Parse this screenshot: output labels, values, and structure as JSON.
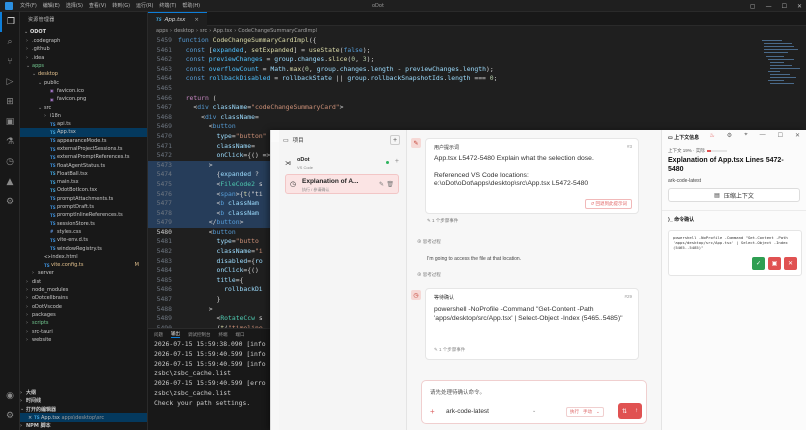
{
  "titlebar": {
    "menus": [
      "文件(F)",
      "编辑(E)",
      "选择(S)",
      "查看(V)",
      "转到(G)",
      "运行(R)",
      "终端(T)",
      "帮助(H)"
    ],
    "title": "oDot"
  },
  "explorer": {
    "header": "资源管理器",
    "root": "ODOT",
    "items": [
      {
        "label": ".codegraph",
        "type": "folder",
        "depth": 1,
        "open": false
      },
      {
        "label": ".github",
        "type": "folder",
        "depth": 1,
        "open": false
      },
      {
        "label": ".idea",
        "type": "folder",
        "depth": 1,
        "open": false
      },
      {
        "label": "apps",
        "type": "folder",
        "depth": 1,
        "open": true,
        "status": "green"
      },
      {
        "label": "desktop",
        "type": "folder",
        "depth": 2,
        "open": true,
        "status": "orange"
      },
      {
        "label": "public",
        "type": "folder",
        "depth": 3,
        "open": true
      },
      {
        "label": "favicon.ico",
        "type": "img",
        "depth": 4
      },
      {
        "label": "favicon.png",
        "type": "img",
        "depth": 4
      },
      {
        "label": "src",
        "type": "folder",
        "depth": 3,
        "open": true
      },
      {
        "label": "i18n",
        "type": "folder",
        "depth": 4,
        "open": false
      },
      {
        "label": "api.ts",
        "type": "ts",
        "depth": 4
      },
      {
        "label": "App.tsx",
        "type": "tsx",
        "depth": 4,
        "selected": true
      },
      {
        "label": "appearanceMode.ts",
        "type": "ts",
        "depth": 4
      },
      {
        "label": "externalProjectSessions.ts",
        "type": "ts",
        "depth": 4
      },
      {
        "label": "externalPromptReferences.ts",
        "type": "ts",
        "depth": 4
      },
      {
        "label": "floatAgentStatus.ts",
        "type": "ts",
        "depth": 4
      },
      {
        "label": "FloatBall.tsx",
        "type": "tsx",
        "depth": 4
      },
      {
        "label": "main.tsx",
        "type": "tsx",
        "depth": 4
      },
      {
        "label": "OdotBotIcon.tsx",
        "type": "tsx",
        "depth": 4
      },
      {
        "label": "promptAttachments.ts",
        "type": "ts",
        "depth": 4
      },
      {
        "label": "promptDraft.ts",
        "type": "ts",
        "depth": 4
      },
      {
        "label": "promptInlineReferences.ts",
        "type": "ts",
        "depth": 4
      },
      {
        "label": "sessionStore.ts",
        "type": "ts",
        "depth": 4
      },
      {
        "label": "styles.css",
        "type": "css",
        "depth": 4
      },
      {
        "label": "vite-env.d.ts",
        "type": "ts",
        "depth": 4
      },
      {
        "label": "windowRegistry.ts",
        "type": "ts",
        "depth": 4
      },
      {
        "label": "index.html",
        "type": "html",
        "depth": 3
      },
      {
        "label": "vite.config.ts",
        "type": "ts",
        "depth": 3,
        "badge": "M"
      },
      {
        "label": "server",
        "type": "folder",
        "depth": 2,
        "open": false
      },
      {
        "label": "dist",
        "type": "folder",
        "depth": 1,
        "open": false
      },
      {
        "label": "node_modules",
        "type": "folder",
        "depth": 1,
        "open": false
      },
      {
        "label": "oDotcellbrains",
        "type": "folder",
        "depth": 1,
        "open": false
      },
      {
        "label": "oDotVscode",
        "type": "folder",
        "depth": 1,
        "open": false
      },
      {
        "label": "packages",
        "type": "folder",
        "depth": 1,
        "open": false
      },
      {
        "label": "scripts",
        "type": "folder",
        "depth": 1,
        "open": false,
        "status": "green"
      },
      {
        "label": "src-tauri",
        "type": "folder",
        "depth": 1,
        "open": false
      },
      {
        "label": "website",
        "type": "folder",
        "depth": 1,
        "open": false
      }
    ],
    "footer": {
      "outline": "大纲",
      "timeline": "时间线",
      "open_editors": "打开的编辑器",
      "open_file": "App.tsx",
      "open_file_path": "apps\\desktop\\src",
      "npm": "NPM 脚本"
    }
  },
  "editor": {
    "tab_label": "App.tsx",
    "breadcrumb": [
      "apps",
      "desktop",
      "src",
      "App.tsx",
      "CodeChangeSummaryCardImpl"
    ],
    "lines": [
      {
        "n": "5459",
        "tokens": [
          [
            "kw",
            "function "
          ],
          [
            "fn",
            "CodeChangeSummaryCardImpl"
          ],
          [
            "pun",
            "({"
          ]
        ]
      },
      {
        "n": "5461",
        "tokens": [
          [
            "pun",
            "  "
          ],
          [
            "kw",
            "const "
          ],
          [
            "pun",
            "["
          ],
          [
            "cst",
            "expanded"
          ],
          [
            "pun",
            ", "
          ],
          [
            "fn",
            "setExpanded"
          ],
          [
            "pun",
            "] = "
          ],
          [
            "fn",
            "useState"
          ],
          [
            "pun",
            "("
          ],
          [
            "kw",
            "false"
          ],
          [
            "pun",
            ");"
          ]
        ]
      },
      {
        "n": "5462",
        "tokens": [
          [
            "pun",
            "  "
          ],
          [
            "kw",
            "const "
          ],
          [
            "cst",
            "previewChanges"
          ],
          [
            "pun",
            " = "
          ],
          [
            "var",
            "group"
          ],
          [
            "pun",
            "."
          ],
          [
            "var",
            "changes"
          ],
          [
            "pun",
            "."
          ],
          [
            "fn",
            "slice"
          ],
          [
            "pun",
            "("
          ],
          [
            "num",
            "0"
          ],
          [
            "pun",
            ", "
          ],
          [
            "num",
            "3"
          ],
          [
            "pun",
            ");"
          ]
        ]
      },
      {
        "n": "5463",
        "tokens": [
          [
            "pun",
            "  "
          ],
          [
            "kw",
            "const "
          ],
          [
            "cst",
            "overflowCount"
          ],
          [
            "pun",
            " = "
          ],
          [
            "var",
            "Math"
          ],
          [
            "pun",
            "."
          ],
          [
            "fn",
            "max"
          ],
          [
            "pun",
            "("
          ],
          [
            "num",
            "0"
          ],
          [
            "pun",
            ", "
          ],
          [
            "var",
            "group"
          ],
          [
            "pun",
            "."
          ],
          [
            "var",
            "changes"
          ],
          [
            "pun",
            "."
          ],
          [
            "var",
            "length"
          ],
          [
            "pun",
            " - "
          ],
          [
            "var",
            "previewChanges"
          ],
          [
            "pun",
            "."
          ],
          [
            "var",
            "length"
          ],
          [
            "pun",
            ");"
          ]
        ]
      },
      {
        "n": "5464",
        "tokens": [
          [
            "pun",
            "  "
          ],
          [
            "kw",
            "const "
          ],
          [
            "cst",
            "rollbackDisabled"
          ],
          [
            "pun",
            " = "
          ],
          [
            "var",
            "rollbackState"
          ],
          [
            "pun",
            " || "
          ],
          [
            "var",
            "group"
          ],
          [
            "pun",
            "."
          ],
          [
            "var",
            "rollbackSnapshotIds"
          ],
          [
            "pun",
            "."
          ],
          [
            "var",
            "length"
          ],
          [
            "pun",
            " === "
          ],
          [
            "num",
            "0"
          ],
          [
            "pun",
            ";"
          ]
        ]
      },
      {
        "n": "5465",
        "tokens": [
          [
            "pun",
            ""
          ]
        ]
      },
      {
        "n": "5466",
        "tokens": [
          [
            "pun",
            "  "
          ],
          [
            "kw2",
            "return"
          ],
          [
            "pun",
            " ("
          ]
        ]
      },
      {
        "n": "5467",
        "tokens": [
          [
            "pun",
            "    <"
          ],
          [
            "kw",
            "div "
          ],
          [
            "att",
            "className"
          ],
          [
            "pun",
            "="
          ],
          [
            "str",
            "\"codeChangeSummaryCard\""
          ],
          [
            "pun",
            ">"
          ]
        ]
      },
      {
        "n": "5468",
        "tokens": [
          [
            "pun",
            "      <"
          ],
          [
            "kw",
            "div "
          ],
          [
            "att",
            "className"
          ],
          [
            "pun",
            "="
          ]
        ]
      },
      {
        "n": "5469",
        "tokens": [
          [
            "pun",
            "        <"
          ],
          [
            "kw",
            "button"
          ]
        ]
      },
      {
        "n": "5470",
        "tokens": [
          [
            "pun",
            "          "
          ],
          [
            "att",
            "type"
          ],
          [
            "pun",
            "="
          ],
          [
            "str",
            "\"button\""
          ]
        ]
      },
      {
        "n": "5471",
        "tokens": [
          [
            "pun",
            "          "
          ],
          [
            "att",
            "className"
          ],
          [
            "pun",
            "="
          ]
        ]
      },
      {
        "n": "5472",
        "tokens": [
          [
            "pun",
            "          "
          ],
          [
            "att",
            "onClick"
          ],
          [
            "pun",
            "={() =>"
          ]
        ]
      },
      {
        "n": "5473",
        "tokens": [
          [
            "pun",
            "        >"
          ]
        ],
        "hl": true
      },
      {
        "n": "5474",
        "tokens": [
          [
            "pun",
            "          {"
          ],
          [
            "var",
            "expanded"
          ],
          [
            "pun",
            " ?"
          ]
        ],
        "hl": true
      },
      {
        "n": "5475",
        "tokens": [
          [
            "pun",
            "          <"
          ],
          [
            "tag",
            "FileCode2"
          ],
          [
            "pun",
            " s"
          ]
        ],
        "hl": true
      },
      {
        "n": "5476",
        "tokens": [
          [
            "pun",
            "          <"
          ],
          [
            "kw",
            "span"
          ],
          [
            "pun",
            ">{"
          ],
          [
            "fn",
            "t"
          ],
          [
            "pun",
            "(\"ti"
          ]
        ],
        "hl": true
      },
      {
        "n": "5477",
        "tokens": [
          [
            "pun",
            "          <"
          ],
          [
            "kw",
            "b "
          ],
          [
            "att",
            "classNam"
          ]
        ],
        "hl": true
      },
      {
        "n": "5478",
        "tokens": [
          [
            "pun",
            "          <"
          ],
          [
            "kw",
            "b "
          ],
          [
            "att",
            "classNam"
          ]
        ],
        "hl": true
      },
      {
        "n": "5479",
        "tokens": [
          [
            "pun",
            "        </"
          ],
          [
            "kw",
            "button"
          ],
          [
            "pun",
            ">"
          ]
        ],
        "hl": true
      },
      {
        "n": "5480",
        "tokens": [
          [
            "pun",
            "        <"
          ],
          [
            "kw",
            "button"
          ]
        ],
        "cur": true
      },
      {
        "n": "5481",
        "tokens": [
          [
            "pun",
            "          "
          ],
          [
            "att",
            "type"
          ],
          [
            "pun",
            "="
          ],
          [
            "str",
            "\"butto"
          ]
        ]
      },
      {
        "n": "5482",
        "tokens": [
          [
            "pun",
            "          "
          ],
          [
            "att",
            "className"
          ],
          [
            "pun",
            "="
          ],
          [
            "str",
            "\"i"
          ]
        ]
      },
      {
        "n": "5483",
        "tokens": [
          [
            "pun",
            "          "
          ],
          [
            "att",
            "disabled"
          ],
          [
            "pun",
            "={"
          ],
          [
            "var",
            "ro"
          ]
        ]
      },
      {
        "n": "5484",
        "tokens": [
          [
            "pun",
            "          "
          ],
          [
            "att",
            "onClick"
          ],
          [
            "pun",
            "={() "
          ]
        ]
      },
      {
        "n": "5485",
        "tokens": [
          [
            "pun",
            "          "
          ],
          [
            "att",
            "title"
          ],
          [
            "pun",
            "={"
          ]
        ]
      },
      {
        "n": "5486",
        "tokens": [
          [
            "pun",
            "            "
          ],
          [
            "var",
            "rollbackDi"
          ]
        ]
      },
      {
        "n": "5487",
        "tokens": [
          [
            "pun",
            "          }"
          ]
        ]
      },
      {
        "n": "5488",
        "tokens": [
          [
            "pun",
            "        >"
          ]
        ]
      },
      {
        "n": "5489",
        "tokens": [
          [
            "pun",
            "          <"
          ],
          [
            "tag",
            "RotateCcw"
          ],
          [
            "pun",
            " s"
          ]
        ]
      },
      {
        "n": "5490",
        "tokens": [
          [
            "pun",
            "          {"
          ],
          [
            "fn",
            "t"
          ],
          [
            "pun",
            "("
          ],
          [
            "str",
            "\"timeline"
          ]
        ]
      }
    ]
  },
  "panel": {
    "tabs": [
      "问题",
      "输出",
      "调试控制台",
      "终端",
      "端口"
    ],
    "active_tab": "输出",
    "lines": [
      "2026-07-15 15:59:38.090 [info",
      "2026-07-15 15:59:40.599 [info",
      "2026-07-15 15:59:40.599 [info",
      "zsbc\\zsbc_cache.list",
      "2026-07-15 15:59:40.599 [erro",
      "zsbc\\zsbc_cache.list",
      "Check your path settings."
    ]
  },
  "assistant": {
    "projects_header": "项目",
    "workspace_name": "oDot",
    "workspace_sub": "VS Code",
    "session_title": "Explanation of A...",
    "session_sub": "执行 / 参请确认",
    "user_msg": {
      "label": "用户提示词",
      "number": "#3",
      "line1": "App.tsx L5472-5480 Explain what the selection dose.",
      "line2": "Referenced VS Code locations:",
      "line3": "e:\\oDot\\oDot\\apps\\desktop\\src\\App.tsx L5472-5480",
      "revert_btn": "回退到此提示词",
      "event": "1 个步骤事件"
    },
    "think1": "思考过程",
    "plain1": "I'm going to access the file at that location.",
    "think2": "思考过程",
    "wait_msg": {
      "label": "等待确认",
      "number": "#29",
      "body": "powershell -NoProfile -Command \"Get-Content -Path 'apps/desktop/src/App.tsx' | Select-Object -Index (5465..5485)\"",
      "event": "1 个步骤事件"
    },
    "composer": {
      "placeholder": "请先处理待确认命令。",
      "model": "ark-code-latest",
      "mode1": "执行",
      "mode2": "手动"
    },
    "context": {
      "header": "上下文信息",
      "usage_label": "上下文 19% · 实际",
      "usage_pct": 0.19,
      "title": "Explanation of App.tsx Lines 5472-5480",
      "model": "ark-code-latest",
      "compress_btn": "压缩上下文",
      "command_header": "命令确认",
      "command": "powershell -NoProfile -Command \"Get-Content -Path 'apps/desktop/src/App.tsx' | Select-Object -Index (5465..5485)\""
    }
  }
}
